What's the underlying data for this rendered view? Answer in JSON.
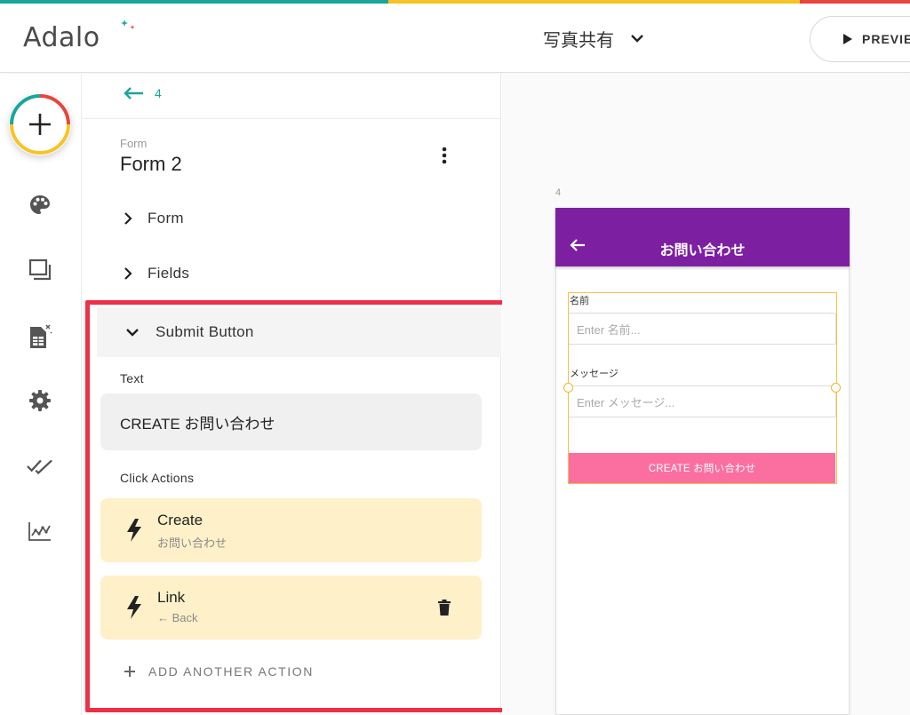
{
  "colors": {
    "brand_teal": "#19a79b",
    "brand_yellow": "#f7c325",
    "brand_red": "#e8453c",
    "highlight_red": "#ee2f48",
    "action_card_bg": "#fef0c8",
    "app_bar_purple": "#7d1fa1",
    "submit_pink": "#fa6fa0"
  },
  "header": {
    "logo_text": "Adalo",
    "app_name": "写真共有",
    "preview_label": "PREVIE"
  },
  "rail": {
    "items": [
      {
        "icon": "plus-icon"
      },
      {
        "icon": "palette-icon"
      },
      {
        "icon": "screens-icon"
      },
      {
        "icon": "database-icon"
      },
      {
        "icon": "gear-icon"
      },
      {
        "icon": "double-check-icon"
      },
      {
        "icon": "analytics-icon"
      }
    ]
  },
  "panel": {
    "back_screen_number": "4",
    "component_type": "Form",
    "component_name": "Form 2",
    "sections": {
      "form": "Form",
      "fields": "Fields",
      "submit_button": "Submit Button"
    },
    "text_label": "Text",
    "text_value": "CREATE お問い合わせ",
    "click_actions_label": "Click Actions",
    "actions": [
      {
        "title": "Create",
        "subtitle": "お問い合わせ"
      },
      {
        "title": "Link",
        "subtitle": "← Back"
      }
    ],
    "add_action_label": "ADD ANOTHER ACTION"
  },
  "preview": {
    "screen_number": "4",
    "app_bar_title": "お問い合わせ",
    "fields": [
      {
        "label": "名前",
        "placeholder": "Enter 名前..."
      },
      {
        "label": "メッセージ",
        "placeholder": "Enter メッセージ..."
      }
    ],
    "submit_label": "CREATE お問い合わせ"
  }
}
